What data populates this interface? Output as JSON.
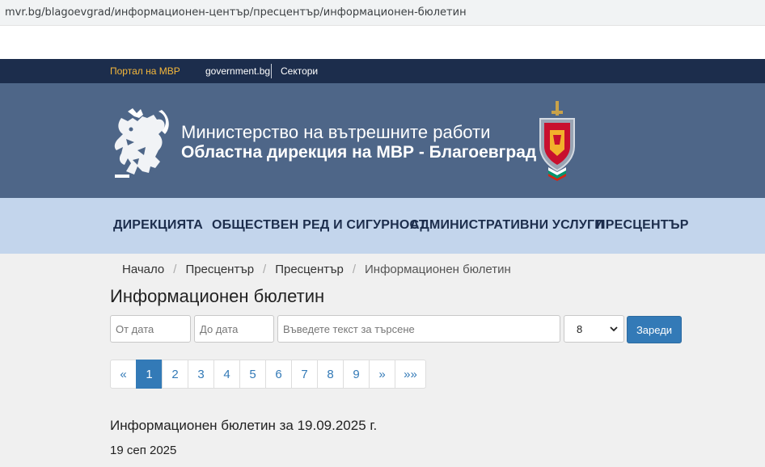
{
  "browser": {
    "url": "mvr.bg/blagoevgrad/информационен-център/пресцентър/информационен-бюлетин"
  },
  "topbar": {
    "portal": "Портал на МВР",
    "government": "government.bg",
    "sectors": "Сектори"
  },
  "header": {
    "line1": "Министерство на вътрешните работи",
    "line2": "Областна дирекция на МВР - Благоевград"
  },
  "nav": {
    "items": [
      "ДИРЕКЦИЯТА",
      "ОБЩЕСТВЕН РЕД И СИГУРНОСТ",
      "АДМИНИСТРАТИВНИ УСЛУГИ",
      "ПРЕСЦЕНТЪР"
    ]
  },
  "breadcrumb": {
    "items": [
      "Начало",
      "Пресцентър",
      "Пресцентър",
      "Информационен бюлетин"
    ]
  },
  "page": {
    "title": "Информационен бюлетин"
  },
  "filters": {
    "from_placeholder": "От дата",
    "to_placeholder": "До дата",
    "search_placeholder": "Въведете текст за търсене",
    "per_page": "8",
    "load_label": "Зареди"
  },
  "pagination": {
    "prev": "«",
    "pages": [
      "1",
      "2",
      "3",
      "4",
      "5",
      "6",
      "7",
      "8",
      "9"
    ],
    "next": "»",
    "last": "»»",
    "active": "1"
  },
  "news": {
    "title": "Информационен бюлетин за 19.09.2025 г.",
    "date": "19 сеп 2025"
  },
  "colors": {
    "topbar": "#1c2d4c",
    "banner": "#4e6688",
    "nav": "#c3d5ec",
    "accent": "#337ab7",
    "portal_link": "#f6b83b"
  }
}
